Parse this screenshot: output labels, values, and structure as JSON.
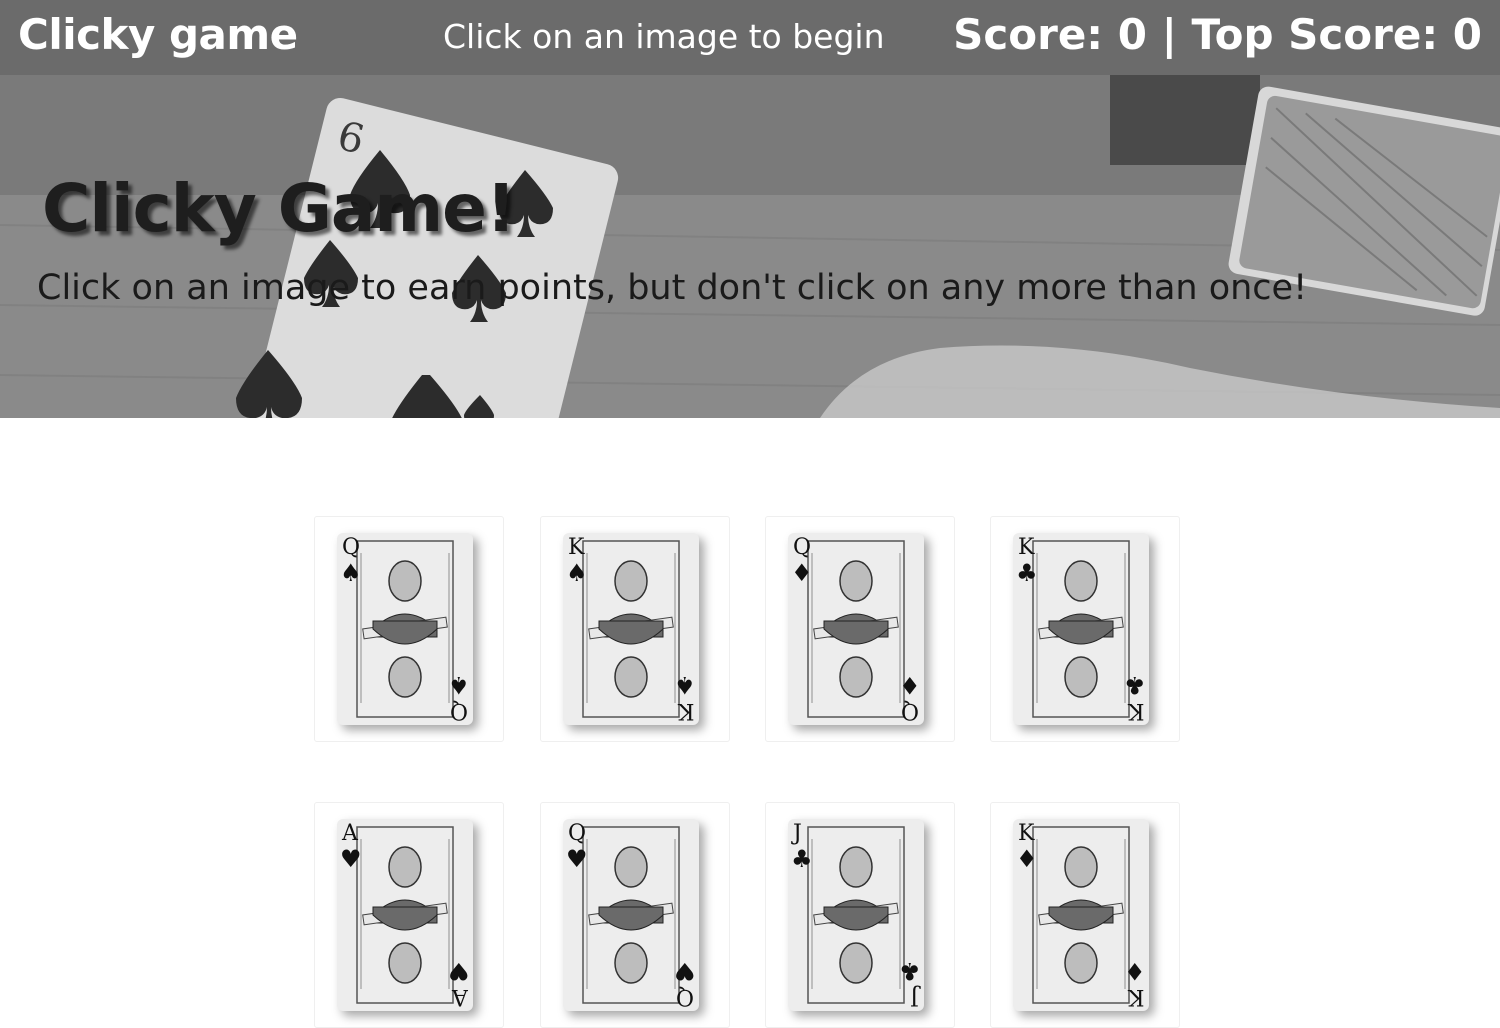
{
  "navbar": {
    "brand": "Clicky game",
    "message": "Click on an image to begin",
    "score_text": "Score: 0 | Top Score: 0",
    "score": 0,
    "top_score": 0
  },
  "hero": {
    "title": "Clicky Game!",
    "subtitle": "Click on an image to earn points, but don't click on any more than once!"
  },
  "cards": [
    {
      "rank": "Q",
      "suit": "♠",
      "icon": "queen-of-spades-portrait-card"
    },
    {
      "rank": "K",
      "suit": "♠",
      "icon": "king-of-spades-portrait-card"
    },
    {
      "rank": "Q",
      "suit": "♦",
      "icon": "queen-of-diamonds-portrait-card"
    },
    {
      "rank": "K",
      "suit": "♣",
      "icon": "king-of-clubs-portrait-card"
    },
    {
      "rank": "A",
      "suit": "♥",
      "icon": "ace-of-hearts-portrait-card"
    },
    {
      "rank": "Q",
      "suit": "♥",
      "icon": "queen-of-hearts-portrait-card"
    },
    {
      "rank": "J",
      "suit": "♣",
      "icon": "jack-of-clubs-portrait-card"
    },
    {
      "rank": "K",
      "suit": "♦",
      "icon": "king-of-diamonds-portrait-card"
    }
  ],
  "colors": {
    "navbar_bg": "#6b6b6b",
    "navbar_text": "#ffffff",
    "page_bg": "#ffffff"
  }
}
